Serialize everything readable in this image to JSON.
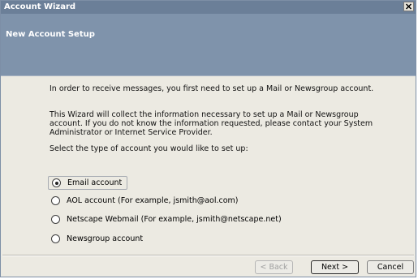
{
  "window": {
    "title": "Account Wizard",
    "close_icon": "close-icon"
  },
  "header": {
    "heading": "New Account Setup"
  },
  "content": {
    "paragraphs": [
      "In order to receive messages, you first need to set up a Mail or Newsgroup account.",
      "This Wizard will collect the information necessary to set up a Mail or Newsgroup account. If you do not know the information requested, please contact your System Administrator or Internet Service Provider.",
      "Select the type of account you would like to set up:"
    ],
    "account_types": [
      {
        "label": "Email account",
        "selected": true
      },
      {
        "label": "AOL account (For example, jsmith@aol.com)",
        "selected": false
      },
      {
        "label": "Netscape Webmail (For example, jsmith@netscape.net)",
        "selected": false
      },
      {
        "label": "Newsgroup account",
        "selected": false
      }
    ]
  },
  "buttons": {
    "back": "< Back",
    "next": "Next >",
    "cancel": "Cancel"
  },
  "colors": {
    "titlebar": "#6b7f98",
    "header_band": "#7f93ab",
    "dialog_background": "#eceae2"
  }
}
